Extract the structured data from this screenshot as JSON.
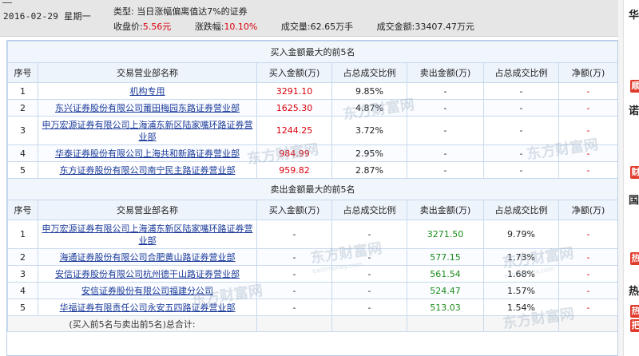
{
  "header": {
    "date": "2016-02-29 星期一",
    "type_label": "类型:",
    "type_value": "当日涨幅偏离值达7%的证券",
    "close_label": "收盘价:",
    "close_value": "5.56元",
    "change_label": "涨跌幅:",
    "change_value": "10.10%",
    "volume_label": "成交量:",
    "volume_value": "62.65万手",
    "amount_label": "成交金额:",
    "amount_value": "33407.47万元"
  },
  "buy": {
    "title": "买入金额最大的前5名",
    "columns": [
      "序号",
      "交易营业部名称",
      "买入金额(万)",
      "占总成交比例",
      "卖出金额(万)",
      "占总成交比例",
      "净额(万)"
    ],
    "rows": [
      {
        "no": "1",
        "dept": "机构专用",
        "buy": "3291.10",
        "buy_pct": "9.85%",
        "sell": "-",
        "sell_pct": "-",
        "net": "-"
      },
      {
        "no": "2",
        "dept": "东兴证券股份有限公司莆田梅园东路证券营业部",
        "buy": "1625.30",
        "buy_pct": "4.87%",
        "sell": "-",
        "sell_pct": "-",
        "net": "-"
      },
      {
        "no": "3",
        "dept": "申万宏源证券有限公司上海浦东新区陆家嘴环路证券营业部",
        "buy": "1244.25",
        "buy_pct": "3.72%",
        "sell": "-",
        "sell_pct": "-",
        "net": "-"
      },
      {
        "no": "4",
        "dept": "华泰证券股份有限公司上海共和新路证券营业部",
        "buy": "984.99",
        "buy_pct": "2.95%",
        "sell": "-",
        "sell_pct": "-",
        "net": "-"
      },
      {
        "no": "5",
        "dept": "东方证券股份有限公司南宁民主路证券营业部",
        "buy": "959.82",
        "buy_pct": "2.87%",
        "sell": "-",
        "sell_pct": "-",
        "net": "-"
      }
    ]
  },
  "sell": {
    "title": "卖出金额最大的前5名",
    "columns": [
      "序号",
      "交易营业部名称",
      "买入金额(万)",
      "占总成交比例",
      "卖出金额(万)",
      "占总成交比例",
      "净额(万)"
    ],
    "rows": [
      {
        "no": "1",
        "dept": "申万宏源证券有限公司上海浦东新区陆家嘴环路证券营业部",
        "buy": "-",
        "buy_pct": "-",
        "sell": "3271.50",
        "sell_pct": "9.79%",
        "net": "-"
      },
      {
        "no": "2",
        "dept": "海通证券股份有限公司合肥黄山路证券营业部",
        "buy": "-",
        "buy_pct": "-",
        "sell": "577.15",
        "sell_pct": "1.73%",
        "net": "-"
      },
      {
        "no": "3",
        "dept": "安信证券股份有限公司杭州德干山路证券营业部",
        "buy": "-",
        "buy_pct": "-",
        "sell": "561.54",
        "sell_pct": "1.68%",
        "net": "-"
      },
      {
        "no": "4",
        "dept": "安信证券股份有限公司福建分公司",
        "buy": "-",
        "buy_pct": "-",
        "sell": "524.47",
        "sell_pct": "1.57%",
        "net": "-"
      },
      {
        "no": "5",
        "dept": "华福证券有限责任公司永安五四路证券营业部",
        "buy": "-",
        "buy_pct": "-",
        "sell": "513.03",
        "sell_pct": "1.54%",
        "net": "-"
      }
    ],
    "footer": "(买入前5名与卖出前5名)总合计:"
  },
  "watermark": {
    "text": "东方财富网",
    "sub": "eastmoney.com"
  },
  "side": {
    "c1": "华",
    "c2": "诺",
    "c3": "国",
    "c4": "热",
    "c5": "把",
    "tag1": "顺",
    "tag2": "财",
    "tag3": "热"
  }
}
